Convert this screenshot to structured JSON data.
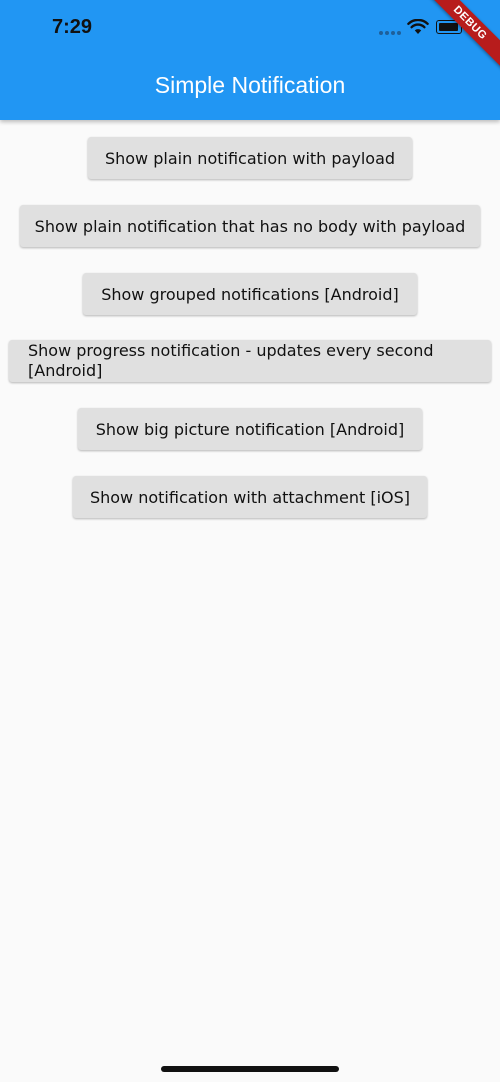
{
  "status_bar": {
    "time": "7:29"
  },
  "debug_banner": "DEBUG",
  "app_bar": {
    "title": "Simple Notification",
    "color": "#2196f3"
  },
  "buttons": [
    {
      "label": "Show plain notification with payload"
    },
    {
      "label": "Show plain notification that has no body with payload"
    },
    {
      "label": "Show grouped notifications [Android]"
    },
    {
      "label": "Show progress notification - updates every second [Android]"
    },
    {
      "label": "Show big picture notification [Android]"
    },
    {
      "label": "Show notification with attachment [iOS]"
    }
  ]
}
